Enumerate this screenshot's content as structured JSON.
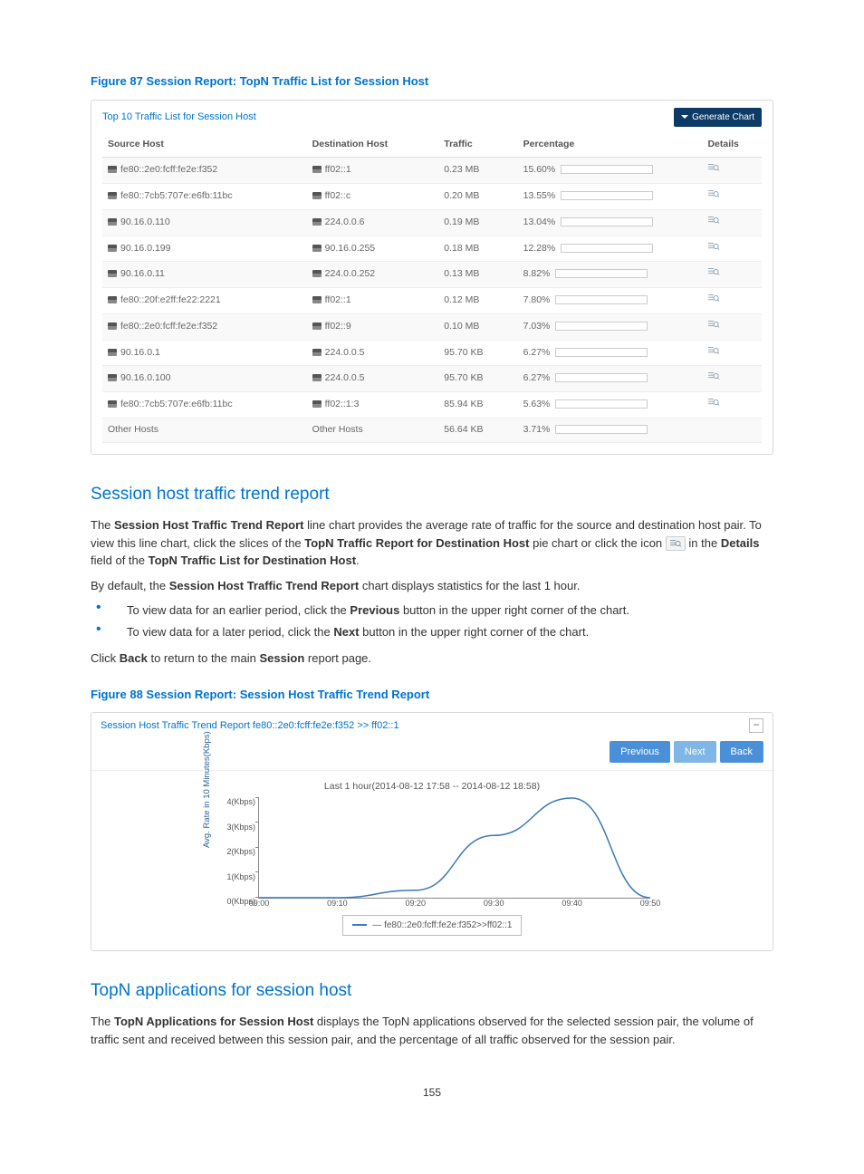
{
  "figure87": {
    "title": "Figure 87 Session Report: TopN Traffic List for Session Host",
    "panel_title": "Top 10 Traffic List for Session Host",
    "generate_chart": "Generate Chart",
    "columns": {
      "src": "Source Host",
      "dst": "Destination Host",
      "traffic": "Traffic",
      "pct": "Percentage",
      "details": "Details"
    },
    "rows": [
      {
        "src": "fe80::2e0:fcff:fe2e:f352",
        "dst": "ff02::1",
        "traffic": "0.23 MB",
        "pct": "15.60%",
        "pct_val": 15.6,
        "icon": true,
        "details": true
      },
      {
        "src": "fe80::7cb5:707e:e6fb:11bc",
        "dst": "ff02::c",
        "traffic": "0.20 MB",
        "pct": "13.55%",
        "pct_val": 13.55,
        "icon": true,
        "details": true
      },
      {
        "src": "90.16.0.110",
        "dst": "224.0.0.6",
        "traffic": "0.19 MB",
        "pct": "13.04%",
        "pct_val": 13.04,
        "icon": true,
        "details": true
      },
      {
        "src": "90.16.0.199",
        "dst": "90.16.0.255",
        "traffic": "0.18 MB",
        "pct": "12.28%",
        "pct_val": 12.28,
        "icon": true,
        "details": true
      },
      {
        "src": "90.16.0.11",
        "dst": "224.0.0.252",
        "traffic": "0.13 MB",
        "pct": "8.82%",
        "pct_val": 8.82,
        "icon": true,
        "details": true
      },
      {
        "src": "fe80::20f:e2ff:fe22:2221",
        "dst": "ff02::1",
        "traffic": "0.12 MB",
        "pct": "7.80%",
        "pct_val": 7.8,
        "icon": true,
        "details": true
      },
      {
        "src": "fe80::2e0:fcff:fe2e:f352",
        "dst": "ff02::9",
        "traffic": "0.10 MB",
        "pct": "7.03%",
        "pct_val": 7.03,
        "icon": true,
        "details": true
      },
      {
        "src": "90.16.0.1",
        "dst": "224.0.0.5",
        "traffic": "95.70 KB",
        "pct": "6.27%",
        "pct_val": 6.27,
        "icon": true,
        "details": true
      },
      {
        "src": "90.16.0.100",
        "dst": "224.0.0.5",
        "traffic": "95.70 KB",
        "pct": "6.27%",
        "pct_val": 6.27,
        "icon": true,
        "details": true
      },
      {
        "src": "fe80::7cb5:707e:e6fb:11bc",
        "dst": "ff02::1:3",
        "traffic": "85.94 KB",
        "pct": "5.63%",
        "pct_val": 5.63,
        "icon": true,
        "details": true
      },
      {
        "src": "Other Hosts",
        "dst": "Other Hosts",
        "traffic": "56.64 KB",
        "pct": "3.71%",
        "pct_val": 3.71,
        "icon": false,
        "details": false
      }
    ]
  },
  "section1": {
    "heading": "Session host traffic trend report",
    "p1a": "The ",
    "p1b": "Session Host Traffic Trend Report",
    "p1c": " line chart provides the average rate of traffic for the source and destination host pair. To view this line chart, click the slices of the ",
    "p1d": "TopN Traffic Report for Destination Host",
    "p1e": " pie chart or click the icon ",
    "p1f": " in the ",
    "p1g": "Details",
    "p1h": " field of the ",
    "p1i": "TopN Traffic List for Destination Host",
    "p1j": ".",
    "p2a": "By default, the ",
    "p2b": "Session Host Traffic Trend Report",
    "p2c": " chart displays statistics for the last 1 hour.",
    "li1a": "To view data for an earlier period, click the ",
    "li1b": "Previous",
    "li1c": " button in the upper right corner of the chart.",
    "li2a": "To view data for a later period, click the ",
    "li2b": "Next",
    "li2c": " button in the upper right corner of the chart.",
    "p3a": "Click ",
    "p3b": "Back",
    "p3c": " to return to the main ",
    "p3d": "Session",
    "p3e": " report page."
  },
  "figure88": {
    "title": "Figure 88 Session Report: Session Host Traffic Trend Report",
    "panel_title": "Session Host Traffic Trend Report fe80::2e0:fcff:fe2e:f352 >> ff02::1",
    "btn_prev": "Previous",
    "btn_next": "Next",
    "btn_back": "Back",
    "caption": "Last 1 hour(2014-08-12 17:58 -- 2014-08-12 18:58)",
    "ylabel": "Avg. Rate in 10 Minutes(Kbps)",
    "legend": "fe80::2e0:fcff:fe2e:f352>>ff02::1"
  },
  "chart_data": {
    "type": "line",
    "title": "Last 1 hour(2014-08-12 17:58 -- 2014-08-12 18:58)",
    "xlabel": "",
    "ylabel": "Avg. Rate in 10 Minutes(Kbps)",
    "x_ticks": [
      "09:00",
      "09:10",
      "09:20",
      "09:30",
      "09:40",
      "09:50"
    ],
    "y_ticks": [
      "0(Kbps)",
      "1(Kbps)",
      "2(Kbps)",
      "3(Kbps)",
      "4(Kbps)"
    ],
    "ylim": [
      0,
      4
    ],
    "series": [
      {
        "name": "fe80::2e0:fcff:fe2e:f352>>ff02::1",
        "x": [
          "09:00",
          "09:10",
          "09:20",
          "09:30",
          "09:40",
          "09:50"
        ],
        "y": [
          0.0,
          0.0,
          0.3,
          2.5,
          4.0,
          0.0
        ]
      }
    ]
  },
  "section2": {
    "heading": "TopN applications for session host",
    "p1a": "The ",
    "p1b": "TopN Applications for Session Host",
    "p1c": " displays the TopN applications observed for the selected session pair, the volume of traffic sent and received between this session pair, and the percentage of all traffic observed for the session pair."
  },
  "page_num": "155"
}
